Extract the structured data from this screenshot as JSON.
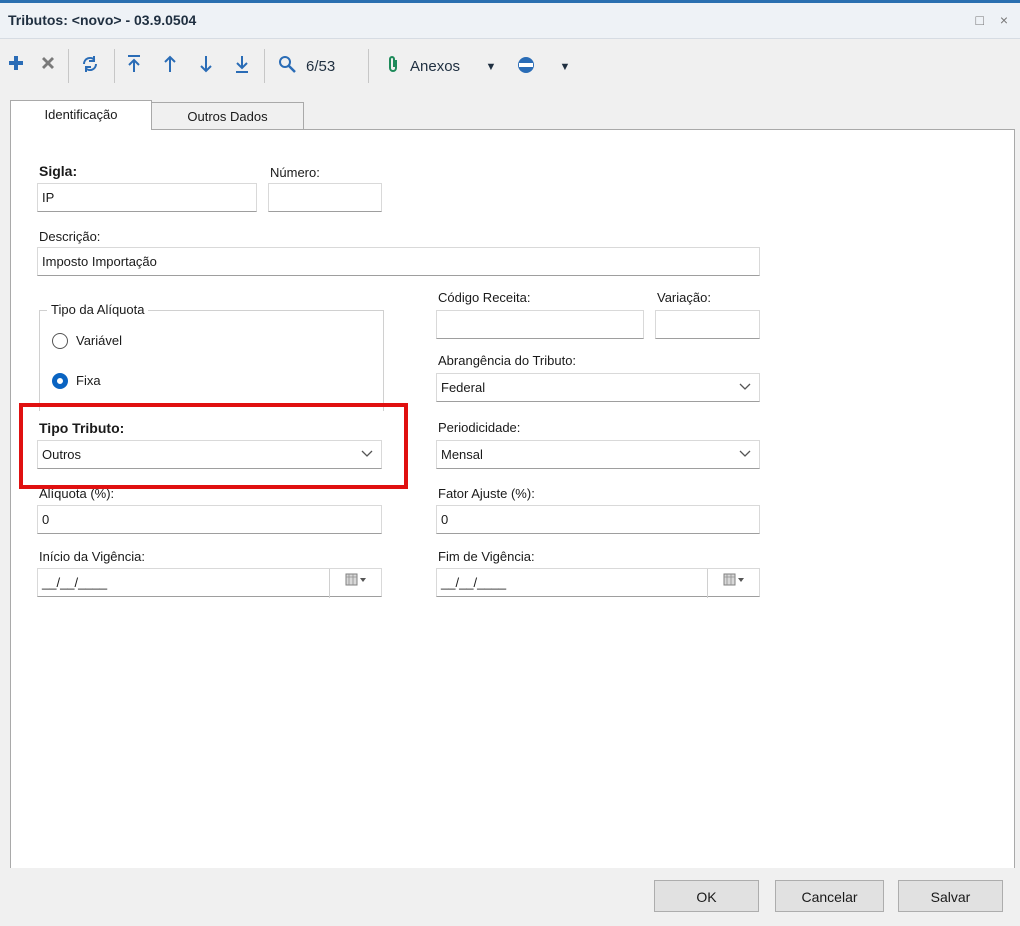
{
  "window": {
    "title": "Tributos: <novo> - 03.9.0504",
    "controls": "□ ×"
  },
  "toolbar": {
    "add_icon": "plus-icon",
    "delete_icon": "x-icon",
    "refresh_icon": "refresh-icon",
    "first_icon": "arrow-top-icon",
    "prev_icon": "arrow-up-icon",
    "next_icon": "arrow-down-icon",
    "last_icon": "arrow-bottom-icon",
    "search_icon": "magnifier-icon",
    "record_counter": "6/53",
    "attachments_label": "Anexos",
    "more_icon": "disc-icon"
  },
  "tabs": [
    {
      "label": "Identificação",
      "active": true
    },
    {
      "label": "Outros Dados",
      "active": false
    }
  ],
  "form": {
    "sigla": {
      "label": "Sigla:",
      "value": "IP"
    },
    "numero": {
      "label": "Número:",
      "value": ""
    },
    "descricao": {
      "label": "Descrição:",
      "value": "Imposto Importação"
    },
    "tipo_aliquota": {
      "label": "Tipo da Alíquota",
      "options": [
        "Variável",
        "Fixa"
      ],
      "selected": "Fixa"
    },
    "codigo_receita": {
      "label": "Código Receita:",
      "value": ""
    },
    "variacao": {
      "label": "Variação:",
      "value": ""
    },
    "abrangencia": {
      "label": "Abrangência do Tributo:",
      "value": "Federal"
    },
    "tipo_tributo": {
      "label": "Tipo Tributo:",
      "value": "Outros"
    },
    "periodicidade": {
      "label": "Periodicidade:",
      "value": "Mensal"
    },
    "aliquota": {
      "label": "Alíquota (%):",
      "value": "0"
    },
    "fator_ajuste": {
      "label": "Fator Ajuste (%):",
      "value": "0"
    },
    "inicio_vigencia": {
      "label": "Início da Vigência:",
      "value": "__/__/____"
    },
    "fim_vigencia": {
      "label": "Fim de Vigência:",
      "value": "__/__/____"
    }
  },
  "buttons": {
    "ok": "OK",
    "cancel": "Cancelar",
    "save": "Salvar"
  },
  "colors": {
    "accent": "#2a6cb6",
    "highlight": "#e01010",
    "radio_selected": "#0a64c2"
  }
}
